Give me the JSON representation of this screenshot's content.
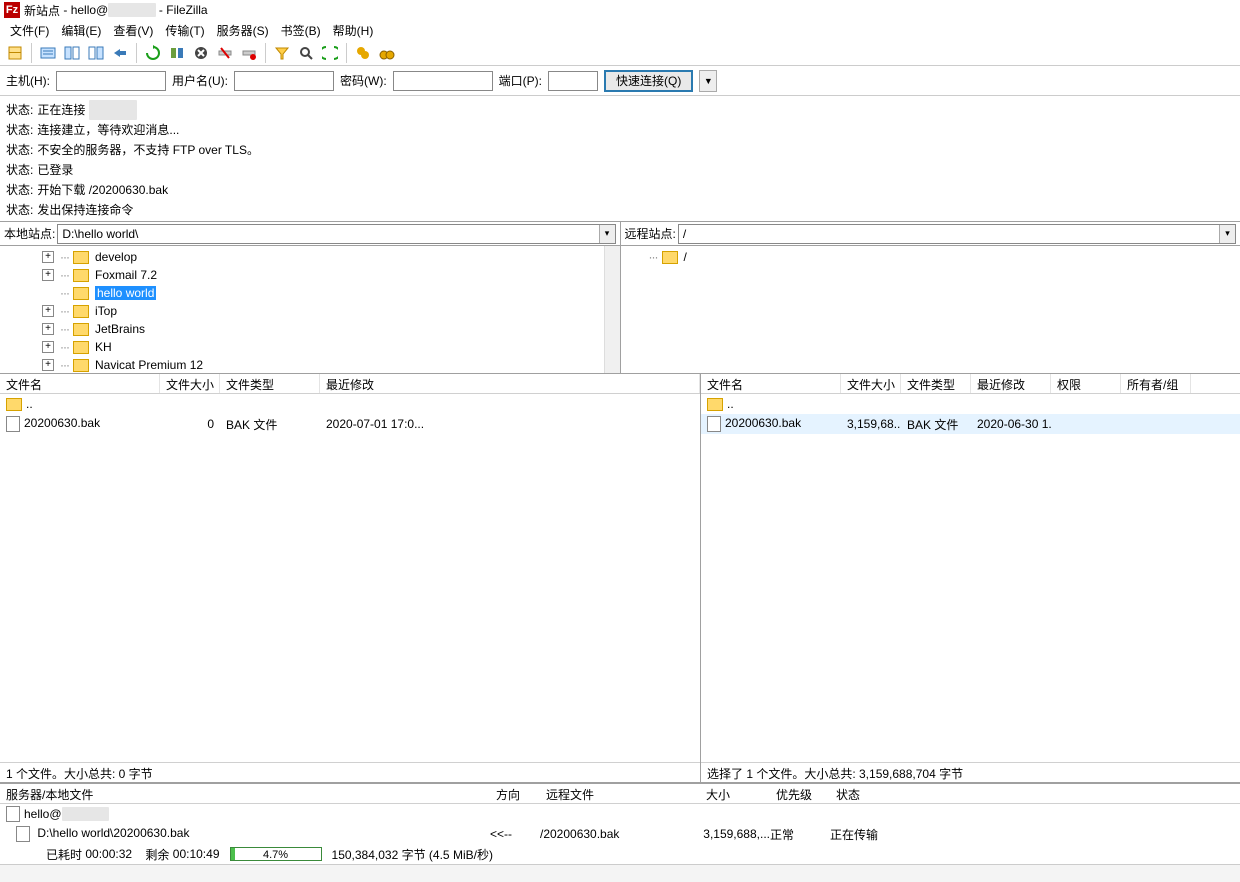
{
  "title": {
    "site": "新站点",
    "user": "hello@",
    "app": "FileZilla"
  },
  "menu": [
    "文件(F)",
    "编辑(E)",
    "查看(V)",
    "传输(T)",
    "服务器(S)",
    "书签(B)",
    "帮助(H)"
  ],
  "toolbar_icons": [
    "site-manager",
    "toggle-log",
    "toggle-local-tree",
    "toggle-remote-tree",
    "toggle-queue",
    "refresh",
    "process-queue",
    "cancel",
    "disconnect",
    "reconnect",
    "filter",
    "search",
    "compare",
    "sync-browse",
    "binoculars"
  ],
  "quickconnect": {
    "host_label": "主机(H):",
    "user_label": "用户名(U):",
    "pass_label": "密码(W):",
    "port_label": "端口(P):",
    "button": "快速连接(Q)"
  },
  "log": [
    {
      "tag": "状态",
      "msg": "正在连接 "
    },
    {
      "tag": "状态",
      "msg": "连接建立，等待欢迎消息..."
    },
    {
      "tag": "状态",
      "msg": "不安全的服务器，不支持 FTP over TLS。"
    },
    {
      "tag": "状态",
      "msg": "已登录"
    },
    {
      "tag": "状态",
      "msg": "开始下载 /20200630.bak"
    },
    {
      "tag": "状态",
      "msg": "发出保持连接命令"
    }
  ],
  "local_site": {
    "label": "本地站点:",
    "path": "D:\\hello world\\"
  },
  "remote_site": {
    "label": "远程站点:",
    "path": "/"
  },
  "local_tree": [
    {
      "name": "develop",
      "exp": "+"
    },
    {
      "name": "Foxmail 7.2",
      "exp": "+"
    },
    {
      "name": "hello world",
      "exp": "",
      "sel": true
    },
    {
      "name": "iTop",
      "exp": "+"
    },
    {
      "name": "JetBrains",
      "exp": "+"
    },
    {
      "name": "KH",
      "exp": "+"
    },
    {
      "name": "Navicat Premium 12",
      "exp": "+"
    }
  ],
  "remote_tree": [
    {
      "name": "/",
      "exp": ""
    }
  ],
  "local_cols": [
    "文件名",
    "文件大小",
    "文件类型",
    "最近修改"
  ],
  "local_col_w": [
    160,
    60,
    100,
    380
  ],
  "local_files": [
    {
      "name": "..",
      "size": "",
      "type": "",
      "mod": "",
      "icon": "fld"
    },
    {
      "name": "20200630.bak",
      "size": "0",
      "type": "BAK 文件",
      "mod": "2020-07-01 17:0...",
      "icon": "file"
    }
  ],
  "local_status": "1 个文件。大小总共: 0 字节",
  "remote_cols": [
    "文件名",
    "文件大小",
    "文件类型",
    "最近修改",
    "权限",
    "所有者/组"
  ],
  "remote_col_w": [
    140,
    60,
    70,
    80,
    70,
    70
  ],
  "remote_files": [
    {
      "name": "..",
      "size": "",
      "type": "",
      "mod": "",
      "perm": "",
      "own": "",
      "icon": "fld"
    },
    {
      "name": "20200630.bak",
      "size": "3,159,68...",
      "type": "BAK 文件",
      "mod": "2020-06-30 1...",
      "perm": "",
      "own": "",
      "icon": "file",
      "sel": true
    }
  ],
  "remote_status": "选择了 1 个文件。大小总共: 3,159,688,704 字节",
  "queue_cols": [
    "服务器/本地文件",
    "方向",
    "远程文件",
    "大小",
    "优先级",
    "状态"
  ],
  "queue_col_w": [
    490,
    50,
    160,
    70,
    60,
    200
  ],
  "queue": {
    "server": "hello@",
    "local": "D:\\hello world\\20200630.bak",
    "dir": "<<--",
    "remote": "/20200630.bak",
    "size": "3,159,688,...",
    "prio": "正常",
    "status": "正在传输",
    "elapsed_label": "已耗时",
    "elapsed": "00:00:32",
    "left_label": "剩余",
    "left": "00:10:49",
    "pct": "4.7%",
    "bytes": "150,384,032 字节 (4.5 MiB/秒)"
  }
}
